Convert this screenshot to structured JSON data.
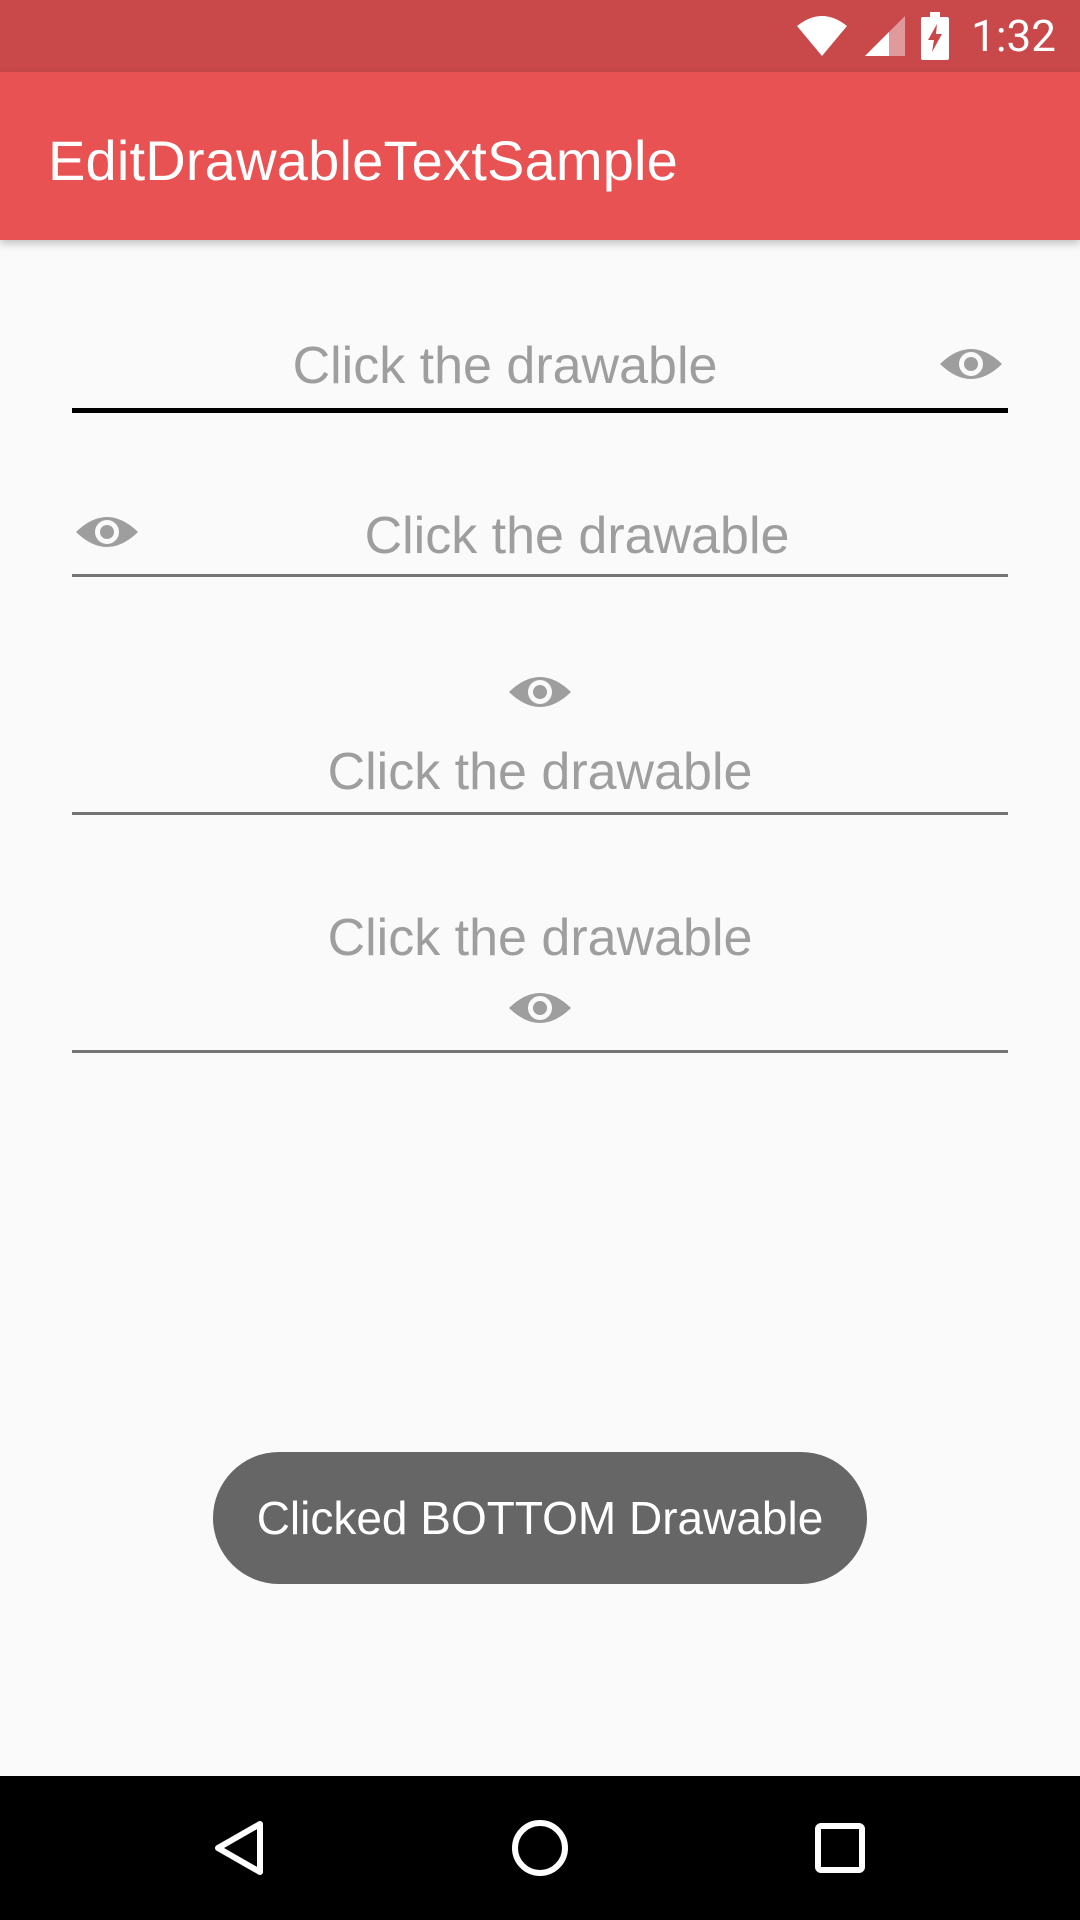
{
  "status_bar": {
    "time": "1:32",
    "icons": [
      "wifi-icon",
      "signal-icon",
      "battery-charging-icon"
    ]
  },
  "app_bar": {
    "title": "EditDrawableTextSample",
    "color": "#e85252"
  },
  "fields": [
    {
      "hint": "Click the drawable",
      "drawable": "eye-icon",
      "drawable_position": "right",
      "focused": true
    },
    {
      "hint": "Click the drawable",
      "drawable": "eye-icon",
      "drawable_position": "left",
      "focused": false
    },
    {
      "hint": "Click the drawable",
      "drawable": "eye-icon",
      "drawable_position": "top",
      "focused": false
    },
    {
      "hint": "Click the drawable",
      "drawable": "eye-icon",
      "drawable_position": "bottom",
      "focused": false
    }
  ],
  "toast": {
    "message": "Clicked BOTTOM Drawable"
  },
  "nav_bar": {
    "buttons": [
      "back-icon",
      "home-icon",
      "recents-icon"
    ]
  }
}
